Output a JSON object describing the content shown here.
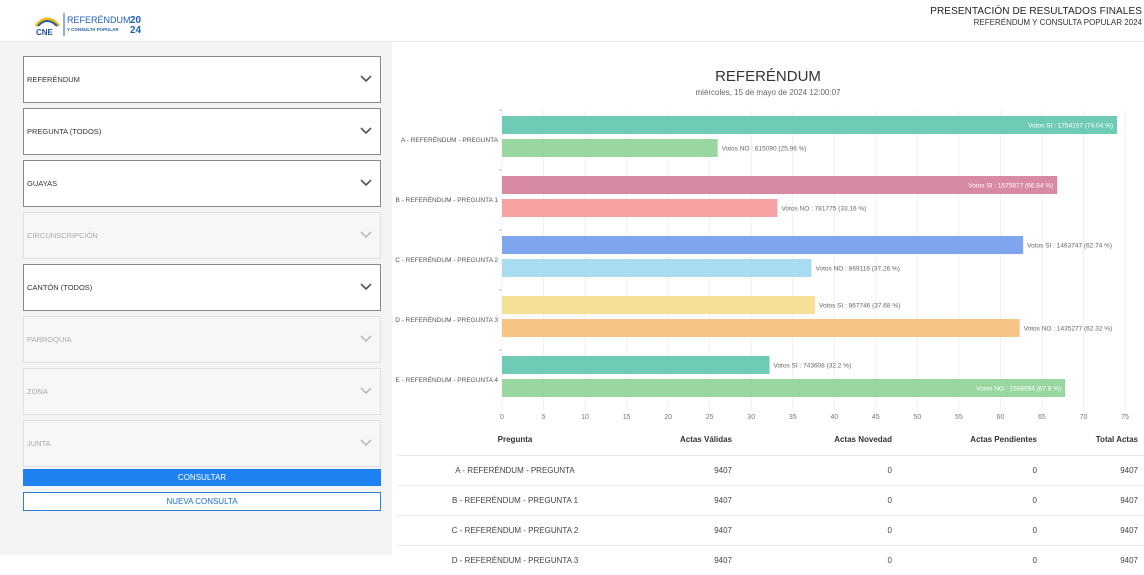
{
  "header": {
    "logo_text": "CNE",
    "brand_line1": "REFERÉNDUM",
    "brand_line2": "Y CONSULTA POPULAR",
    "brand_year_top": "20",
    "brand_year_bottom": "24",
    "title": "PRESENTACIÓN DE RESULTADOS FINALES",
    "subtitle": "REFERÉNDUM Y CONSULTA POPULAR 2024"
  },
  "filters": [
    {
      "label": "REFERÉNDUM",
      "enabled": true
    },
    {
      "label": "PREGUNTA (TODOS)",
      "enabled": true
    },
    {
      "label": "GUAYAS",
      "enabled": true
    },
    {
      "label": "CIRCUNSCRIPCIÓN",
      "enabled": false
    },
    {
      "label": "CANTÓN (TODOS)",
      "enabled": true
    },
    {
      "label": "PARROQUIA",
      "enabled": false
    },
    {
      "label": "ZONA",
      "enabled": false
    },
    {
      "label": "JUNTA",
      "enabled": false
    }
  ],
  "buttons": {
    "consultar": "CONSULTAR",
    "nueva": "NUEVA CONSULTA"
  },
  "chart_data": {
    "type": "bar",
    "orientation": "horizontal",
    "title": "REFERÉNDUM",
    "subtitle": "miércoles, 15 de mayo de 2024 12:00:07",
    "xlim": [
      0,
      75
    ],
    "xticks": [
      0,
      5,
      10,
      15,
      20,
      25,
      30,
      35,
      40,
      45,
      50,
      55,
      60,
      65,
      70,
      75
    ],
    "categories": [
      "A - REFERÉNDUM - PREGUNTA",
      "B - REFERÉNDUM - PREGUNTA 1",
      "C - REFERÉNDUM - PREGUNTA 2",
      "D - REFERÉNDUM - PREGUNTA 3",
      "E - REFERÉNDUM - PREGUNTA 4"
    ],
    "bars": [
      {
        "value": 74.04,
        "label": "Votos SI : 1754157  (74.04 %)",
        "color": "#6fcbb5",
        "inside": true
      },
      {
        "value": 25.96,
        "label": "Votos NO : 615090  (25.96 %)",
        "color": "#9ad6a0",
        "inside": false
      },
      {
        "value": 66.84,
        "label": "Votos SI : 1575877  (66.84 %)",
        "color": "#d98aa3",
        "inside": true
      },
      {
        "value": 33.16,
        "label": "Votos NO : 781775  (33.16 %)",
        "color": "#f7a3a3",
        "inside": false
      },
      {
        "value": 62.74,
        "label": "Votos SI : 1463747  (62.74 %)",
        "color": "#7fa5ee",
        "inside": false
      },
      {
        "value": 37.26,
        "label": "Votos NO : 869116  (37.26 %)",
        "color": "#a8dcf0",
        "inside": false
      },
      {
        "value": 37.68,
        "label": "Votos SI : 867746  (37.68 %)",
        "color": "#f6e095",
        "inside": false
      },
      {
        "value": 62.32,
        "label": "Votos NO : 1435277  (62.32 %)",
        "color": "#f6c585",
        "inside": false
      },
      {
        "value": 32.2,
        "label": "Votos SI : 743608  (32.2 %)",
        "color": "#6fcbb5",
        "inside": false
      },
      {
        "value": 67.8,
        "label": "Votos NO : 1566084  (67.8 %)",
        "color": "#9ad6a0",
        "inside": true
      }
    ]
  },
  "table": {
    "headers": [
      "Pregunta",
      "Actas Válidas",
      "Actas Novedad",
      "Actas Pendientes",
      "Total Actas"
    ],
    "rows": [
      [
        "A - REFERÉNDUM - PREGUNTA",
        "9407",
        "0",
        "0",
        "9407"
      ],
      [
        "B - REFERÉNDUM - PREGUNTA 1",
        "9407",
        "0",
        "0",
        "9407"
      ],
      [
        "C - REFERÉNDUM - PREGUNTA 2",
        "9407",
        "0",
        "0",
        "9407"
      ],
      [
        "D - REFERÉNDUM - PREGUNTA 3",
        "9407",
        "0",
        "0",
        "9407"
      ]
    ]
  }
}
